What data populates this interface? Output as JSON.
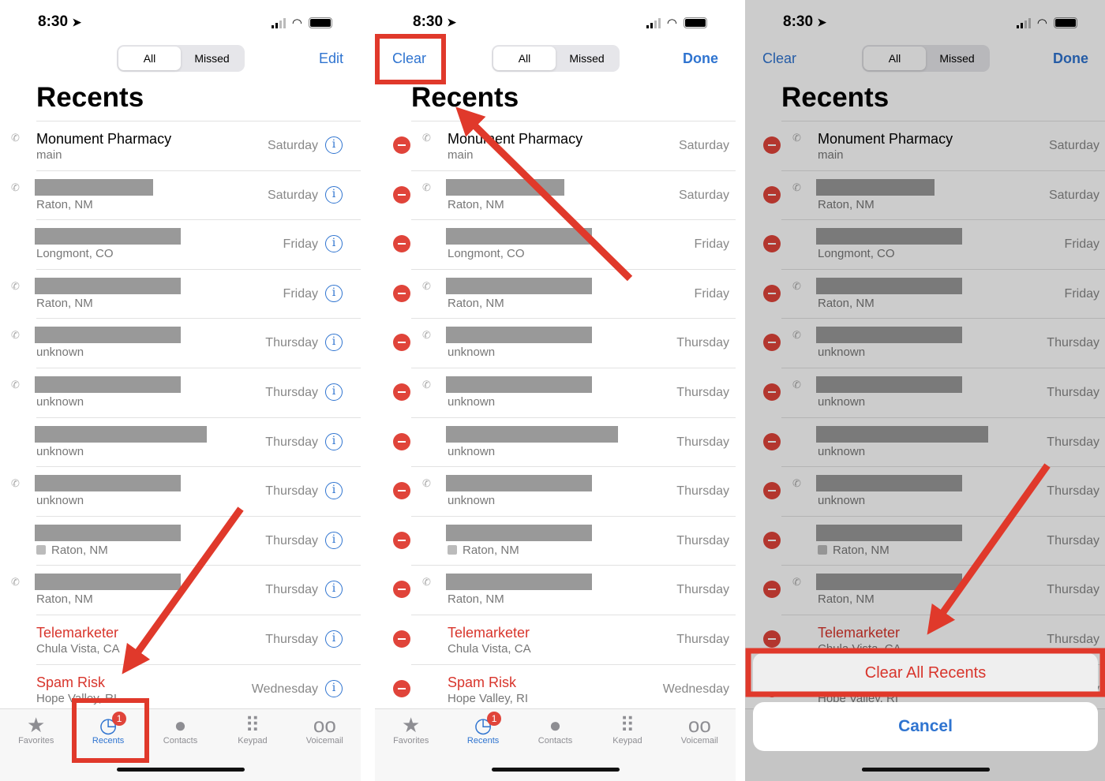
{
  "status": {
    "time": "8:30",
    "location_icon": "location-arrow-icon"
  },
  "segments": [
    "All",
    "Missed"
  ],
  "title": "Recents",
  "nav": {
    "edit": "Edit",
    "clear": "Clear",
    "done": "Done"
  },
  "rows": [
    {
      "name": "Monument Pharmacy",
      "sub": "main",
      "day": "Saturday",
      "outgoing": true
    },
    {
      "name": "",
      "redacted": true,
      "rw": 150,
      "sub": "Raton, NM",
      "day": "Saturday",
      "outgoing": true
    },
    {
      "name": "",
      "redacted": true,
      "rw": 185,
      "sub": "Longmont, CO",
      "day": "Friday",
      "outgoing": false
    },
    {
      "name": "",
      "redacted": true,
      "rw": 185,
      "sub": "Raton, NM",
      "day": "Friday",
      "outgoing": true
    },
    {
      "name": "",
      "redacted": true,
      "rw": 185,
      "sub": "unknown",
      "day": "Thursday",
      "outgoing": true
    },
    {
      "name": "",
      "redacted": true,
      "rw": 185,
      "sub": "unknown",
      "day": "Thursday",
      "outgoing": true
    },
    {
      "name": "",
      "redacted": true,
      "rw": 218,
      "sub": "unknown",
      "day": "Thursday",
      "outgoing": false
    },
    {
      "name": "",
      "redacted": true,
      "rw": 185,
      "sub": "unknown",
      "day": "Thursday",
      "outgoing": true
    },
    {
      "name": "",
      "redacted": true,
      "rw": 185,
      "sub": "Raton, NM",
      "checkbox": true,
      "day": "Thursday",
      "outgoing": false
    },
    {
      "name": "",
      "redacted": true,
      "rw": 185,
      "sub": "Raton, NM",
      "day": "Thursday",
      "outgoing": true
    },
    {
      "name": "Telemarketer",
      "red": true,
      "sub": "Chula Vista, CA",
      "day": "Thursday",
      "outgoing": false
    },
    {
      "name": "Spam Risk",
      "red": true,
      "sub": "Hope Valley, RI",
      "day": "Wednesday",
      "outgoing": false
    }
  ],
  "tabs": [
    {
      "label": "Favorites",
      "icon": "star-icon"
    },
    {
      "label": "Recents",
      "icon": "clock-icon",
      "badge": "1"
    },
    {
      "label": "Contacts",
      "icon": "person-circle-icon"
    },
    {
      "label": "Keypad",
      "icon": "keypad-icon"
    },
    {
      "label": "Voicemail",
      "icon": "voicemail-icon"
    }
  ],
  "action_sheet": {
    "clear_all": "Clear All Recents",
    "cancel": "Cancel"
  },
  "colors": {
    "accent": "#2f74d0",
    "destructive": "#d8352c",
    "annotation": "#e0392b"
  }
}
